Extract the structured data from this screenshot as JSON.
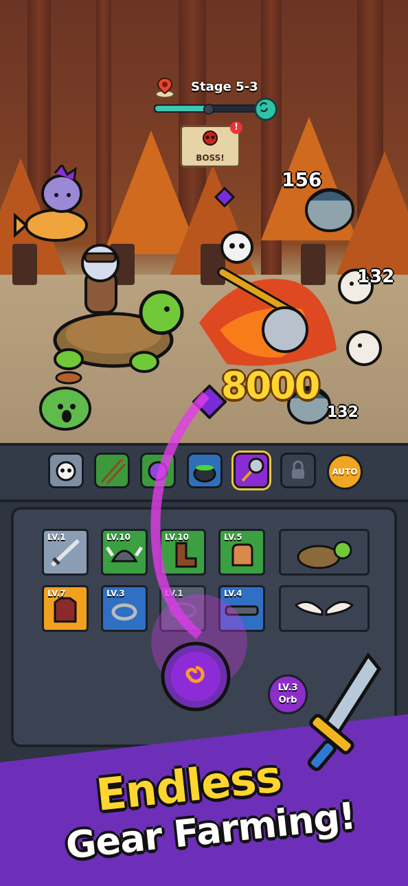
{
  "stage": {
    "label": "Stage 5-3",
    "progress": 0.5
  },
  "boss": {
    "label": "BOSS!",
    "alert": "!"
  },
  "damage": {
    "enemy_top": "156",
    "enemy_mid": "132",
    "enemy_bottom": "132",
    "critical": "8000"
  },
  "skills": [
    {
      "icon": "skull-bomb-icon"
    },
    {
      "icon": "arrow-volley-icon"
    },
    {
      "icon": "green-orb-icon"
    },
    {
      "icon": "cauldron-icon"
    },
    {
      "icon": "battle-axe-icon",
      "selected": true
    },
    {
      "icon": "lock-icon",
      "locked": true
    }
  ],
  "auto": {
    "label": "AUTO"
  },
  "gear": [
    {
      "level": "LV.1",
      "icon": "sword-icon",
      "rarity": "gray"
    },
    {
      "level": "LV.10",
      "icon": "viking-helmet-icon",
      "rarity": "green"
    },
    {
      "level": "LV.10",
      "icon": "boot-icon",
      "rarity": "green"
    },
    {
      "level": "LV.5",
      "icon": "glove-icon",
      "rarity": "green"
    },
    {
      "level": "LV.7",
      "icon": "armor-icon",
      "rarity": "orange"
    },
    {
      "level": "LV.3",
      "icon": "ring-icon",
      "rarity": "blue"
    },
    {
      "level": "LV.1",
      "icon": "necklace-icon",
      "rarity": "ghost"
    },
    {
      "level": "LV.4",
      "icon": "belt-icon",
      "rarity": "blue"
    }
  ],
  "pets": [
    {
      "icon": "turtle-mount-icon"
    },
    {
      "icon": "wings-icon"
    }
  ],
  "orb": {
    "level": "LV.3",
    "label": "Orb"
  },
  "headline": {
    "line1": "Endless",
    "line2": "Gear Farming!"
  },
  "colors": {
    "accent": "#6e2fb8",
    "gold": "#ffd531",
    "teal": "#3cc7b3"
  }
}
